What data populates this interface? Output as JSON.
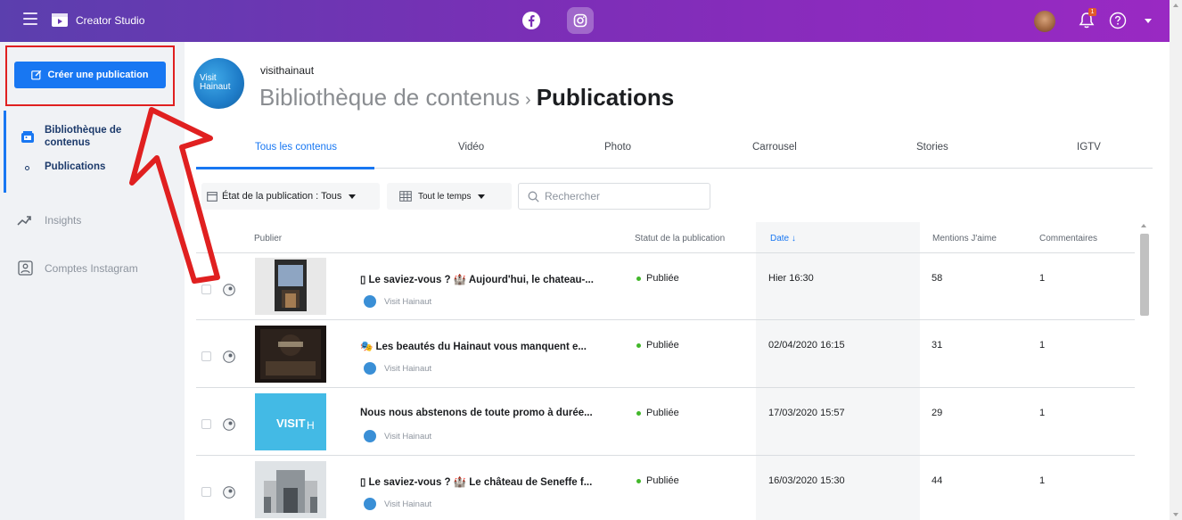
{
  "app": {
    "title": "Creator Studio"
  },
  "page": {
    "handle": "visithainaut",
    "logo_text_1": "Visit",
    "logo_text_2": "Hainaut",
    "breadcrumb_parent": "Bibliothèque de contenus",
    "breadcrumb_separator": "›",
    "breadcrumb_current": "Publications"
  },
  "notifications": {
    "count": "1"
  },
  "sidebar": {
    "create_button": "Créer une publication",
    "items": [
      {
        "label": "Bibliothèque de contenus",
        "icon": "content-library-icon"
      },
      {
        "label": "Publications"
      },
      {
        "label": "Insights",
        "icon": "insights-icon"
      },
      {
        "label": "Comptes Instagram",
        "icon": "instagram-accounts-icon"
      }
    ]
  },
  "tabs": [
    {
      "label": "Tous les contenus",
      "active": true
    },
    {
      "label": "Vidéo"
    },
    {
      "label": "Photo"
    },
    {
      "label": "Carrousel"
    },
    {
      "label": "Stories"
    },
    {
      "label": "IGTV"
    }
  ],
  "filters": {
    "status_label": "État de la publication : Tous",
    "time_label": "Tout le temps",
    "search_placeholder": "Rechercher"
  },
  "table": {
    "columns": [
      "Publier",
      "Statut de la publication",
      "Date ↓",
      "Mentions J'aime",
      "Commentaires"
    ],
    "rows": [
      {
        "text": "▯ Le saviez-vous ? 🏰 Aujourd'hui, le chateau-...",
        "author": "Visit Hainaut",
        "status": "Publiée",
        "date": "Hier 16:30",
        "likes": "58",
        "comments": "1"
      },
      {
        "text": "🎭 Les beautés du Hainaut vous manquent e...",
        "author": "Visit Hainaut",
        "status": "Publiée",
        "date": "02/04/2020 16:15",
        "likes": "31",
        "comments": "1"
      },
      {
        "text": "Nous nous abstenons de toute promo à durée...",
        "author": "Visit Hainaut",
        "status": "Publiée",
        "date": "17/03/2020 15:57",
        "likes": "29",
        "comments": "1"
      },
      {
        "text": "▯ Le saviez-vous ? 🏰 Le château de Seneffe f...",
        "author": "Visit Hainaut",
        "status": "Publiée",
        "date": "16/03/2020 15:30",
        "likes": "44",
        "comments": "1"
      }
    ]
  },
  "colors": {
    "topbar_start": "#5b3fae",
    "topbar_end": "#9a29c3",
    "accent": "#1877f2",
    "status_published": "#42b72a",
    "annotation": "#e02020"
  }
}
